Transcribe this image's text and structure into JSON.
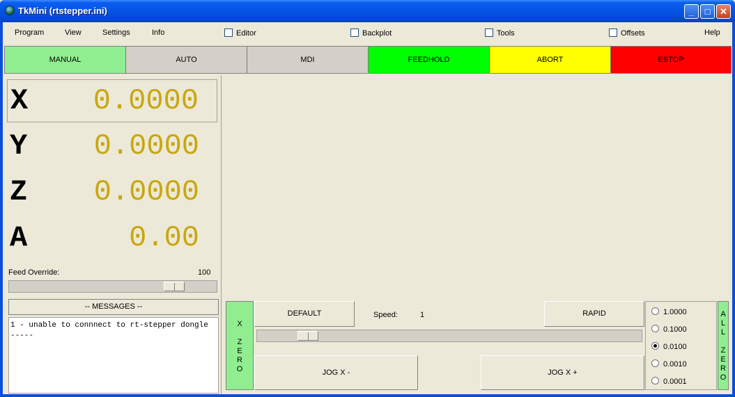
{
  "window": {
    "title": "TkMini (rtstepper.ini)"
  },
  "menu": {
    "program": "Program",
    "view": "View",
    "settings": "Settings",
    "info": "Info",
    "help": "Help"
  },
  "toggles": {
    "editor": "Editor",
    "backplot": "Backplot",
    "tools": "Tools",
    "offsets": "Offsets"
  },
  "modes": {
    "manual": "MANUAL",
    "auto": "AUTO",
    "mdi": "MDI",
    "feedhold": "FEEDHOLD",
    "abort": "ABORT",
    "estop": "ESTOP"
  },
  "colors": {
    "manual": "#90ee90",
    "auto": "#d4d0c8",
    "mdi": "#d4d0c8",
    "feedhold": "#00ff00",
    "abort": "#ffff00",
    "estop": "#ff0000",
    "dro_value": "#c9a70d"
  },
  "dro": {
    "x": {
      "label": "X",
      "value": "0.0000"
    },
    "y": {
      "label": "Y",
      "value": "0.0000"
    },
    "z": {
      "label": "Z",
      "value": "0.0000"
    },
    "a": {
      "label": "A",
      "value": "0.00"
    }
  },
  "feed_override": {
    "label": "Feed Override:",
    "value": "100"
  },
  "messages": {
    "button": "-- MESSAGES --",
    "text": "1 - unable to connnect to rt-stepper dongle\n-----"
  },
  "jog": {
    "zero_x": [
      "X",
      "",
      "Z",
      "E",
      "R",
      "O"
    ],
    "default": "DEFAULT",
    "speed_label": "Speed:",
    "speed_value": "1",
    "rapid": "RAPID",
    "jog_minus": "JOG X -",
    "jog_plus": "JOG X +",
    "increments": [
      "1.0000",
      "0.1000",
      "0.0100",
      "0.0010",
      "0.0001"
    ],
    "selected_increment": "0.0100",
    "all_zero": [
      "A",
      "L",
      "L",
      "",
      "Z",
      "E",
      "R",
      "O"
    ]
  }
}
